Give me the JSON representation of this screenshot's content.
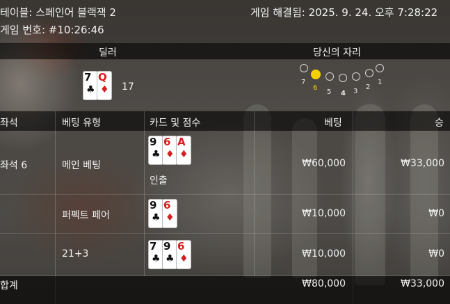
{
  "header": {
    "table_label": "테이블: 스페인어 블랙잭 2",
    "resolved_label": "게임 해결됨: 2025. 9. 24. 오후 7:28:22",
    "game_number": "게임 번호: #10:26:46"
  },
  "dealer_section": {
    "dealer_label": "딜러",
    "seat_label": "당신의 자리",
    "dealer_cards": [
      {
        "rank": "7",
        "suit": "♣",
        "color": "black"
      },
      {
        "rank": "Q",
        "suit": "♦",
        "color": "red"
      }
    ],
    "dealer_score": "17",
    "seats": [
      "1",
      "2",
      "3",
      "4",
      "5",
      "6",
      "7"
    ],
    "my_seat": "6"
  },
  "table": {
    "headers": {
      "seat": "좌석",
      "bet_type": "베팅 유형",
      "cards": "카드 및 점수",
      "bet": "베팅",
      "win": "승"
    },
    "rows": [
      {
        "seat": "좌석 6",
        "bet_type": "메인 베팅",
        "cards": [
          {
            "rank": "9",
            "suit": "♣",
            "color": "black"
          },
          {
            "rank": "6",
            "suit": "♦",
            "color": "red"
          },
          {
            "rank": "A",
            "suit": "♦",
            "color": "red"
          }
        ],
        "note": "인출",
        "bet": "₩60,000",
        "win": "₩33,000"
      },
      {
        "seat": "",
        "bet_type": "퍼펙트 페어",
        "cards": [
          {
            "rank": "9",
            "suit": "♣",
            "color": "black"
          },
          {
            "rank": "6",
            "suit": "♦",
            "color": "red"
          }
        ],
        "note": "",
        "bet": "₩10,000",
        "win": "₩0"
      },
      {
        "seat": "",
        "bet_type": "21+3",
        "cards": [
          {
            "rank": "7",
            "suit": "♣",
            "color": "black"
          },
          {
            "rank": "9",
            "suit": "♣",
            "color": "black"
          },
          {
            "rank": "6",
            "suit": "♦",
            "color": "red"
          }
        ],
        "note": "",
        "bet": "₩10,000",
        "win": "₩0"
      }
    ],
    "total": {
      "label": "합계",
      "bet": "₩80,000",
      "win": "₩33,000"
    }
  }
}
